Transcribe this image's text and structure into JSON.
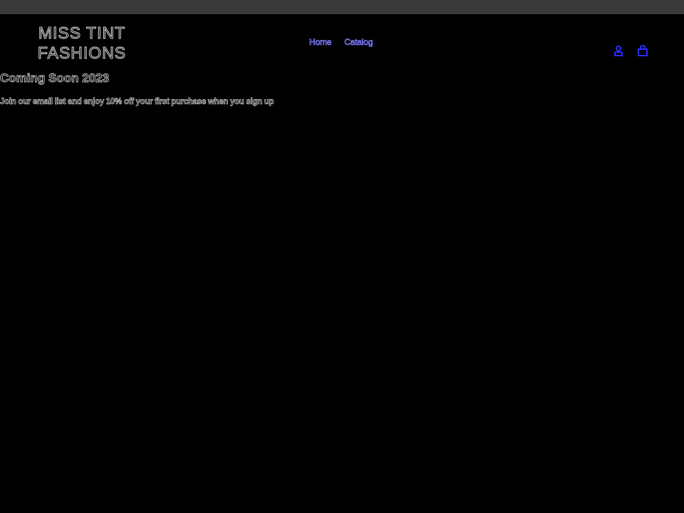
{
  "brand": {
    "line1": "MISS TINT",
    "line2": "FASHIONS"
  },
  "nav": {
    "items": [
      {
        "label": "Home"
      },
      {
        "label": "Catalog"
      }
    ]
  },
  "header_icons": {
    "account": "user-icon",
    "cart": "shopping-bag-icon"
  },
  "main": {
    "headline": "Coming Soon 2023",
    "subtext": "Join our email list and enjoy 10% off your first purchase when you sign up"
  },
  "colors": {
    "background": "#000000",
    "top_bar": "#3a3a3a",
    "link": "#7b7bff",
    "icon": "#2b2bff",
    "text_outline": "#cfcfcf"
  }
}
